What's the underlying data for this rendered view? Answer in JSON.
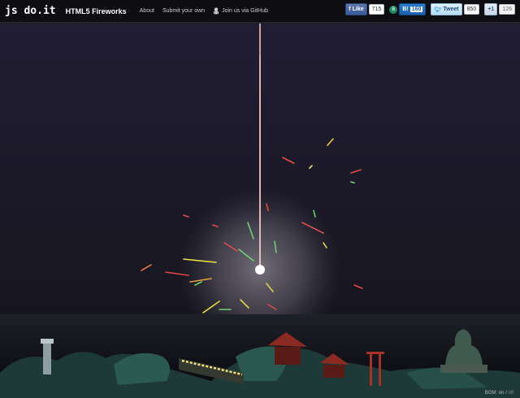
{
  "header": {
    "logo": "js do.it",
    "title": "HTML5 Fireworks",
    "nav": {
      "about": "About",
      "submit": "Submit your own",
      "github": "Join us via GitHub"
    }
  },
  "social": {
    "facebook": {
      "label": "Like",
      "count": "715"
    },
    "hatena": {
      "count": "160"
    },
    "twitter": {
      "label": "Tweet",
      "count": "850"
    },
    "google": {
      "label": "+1",
      "count": "126"
    }
  },
  "footer": {
    "bgm_label": "BGM:",
    "on": "on",
    "sep": "/",
    "off": "off"
  },
  "colors": {
    "sky": "#1f1c2e",
    "topbar": "#0e0e12",
    "water": "#08090d",
    "trail": "#f2c9c2"
  },
  "icons": [
    "github-icon",
    "hatena-icon",
    "twitter-icon",
    "facebook-icon",
    "google-plus-icon"
  ]
}
